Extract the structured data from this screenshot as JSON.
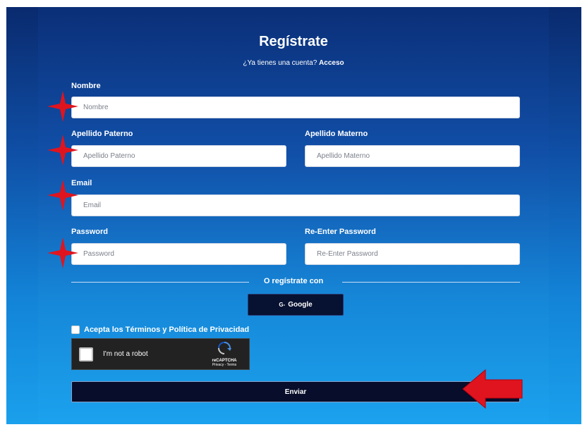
{
  "form": {
    "title": "Regístrate",
    "subtitle_prefix": "¿Ya tienes una cuenta?",
    "login_link": "Acceso"
  },
  "fields": {
    "nombre": {
      "label": "Nombre",
      "placeholder": "Nombre"
    },
    "apellido_paterno": {
      "label": "Apellido Paterno",
      "placeholder": "Apellido Paterno"
    },
    "apellido_materno": {
      "label": "Apellido Materno",
      "placeholder": "Apellido Materno"
    },
    "email": {
      "label": "Email",
      "placeholder": "Email"
    },
    "password": {
      "label": "Password",
      "placeholder": "Password"
    },
    "reenter_password": {
      "label": "Re-Enter Password",
      "placeholder": "Re-Enter Password"
    }
  },
  "social": {
    "divider_text": "O regístrate con",
    "google_icon": "G-",
    "google_label": "Google"
  },
  "terms": {
    "label": "Acepta los Términos y Política de Privacidad"
  },
  "captcha": {
    "label": "I'm not a robot",
    "brand": "reCAPTCHA",
    "links": "Privacy - Terms"
  },
  "submit": {
    "label": "Enviar"
  },
  "annotations": {
    "star_color": "#e0141e",
    "arrow_color": "#e0141e"
  }
}
